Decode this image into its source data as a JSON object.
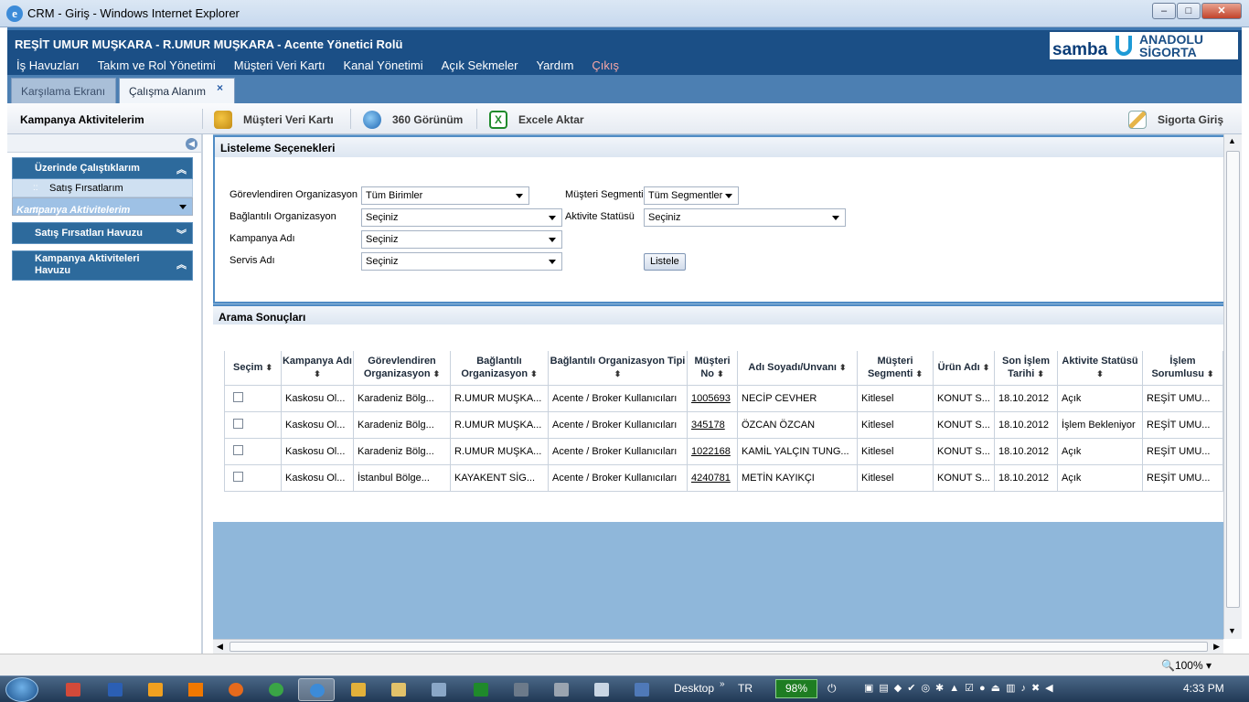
{
  "window": {
    "title": "CRM - Giriş - Windows Internet Explorer",
    "ie_icon": "e"
  },
  "header": {
    "title": "REŞİT UMUR MUŞKARA - R.UMUR MUŞKARA - Acente Yönetici Rolü",
    "logo_left": "samba",
    "logo_right_1": "ANADOLU",
    "logo_right_2": "SİGORTA"
  },
  "menu": [
    "İş Havuzları",
    "Takım ve Rol Yönetimi",
    "Müşteri Veri Kartı",
    "Kanal Yönetimi",
    "Açık Sekmeler",
    "Yardım",
    "Çıkış"
  ],
  "tabs": [
    "Karşılama Ekranı",
    "Çalışma Alanım"
  ],
  "toolbar": {
    "crumb": "Kampanya Aktivitelerim",
    "veri_karti": "Müşteri Veri Kartı",
    "gorunum": "360 Görünüm",
    "excel": "Excele Aktar",
    "sigorta": "Sigorta Giriş"
  },
  "sidebar": {
    "group1": "Üzerinde Çalıştıklarım",
    "items": [
      "Satış Fırsatlarım",
      "Kampanya Aktivitelerim"
    ],
    "group2": "Satış Fırsatları Havuzu",
    "group3": "Kampanya Aktiviteleri Havuzu"
  },
  "filters": {
    "title": "Listeleme Seçenekleri",
    "gorev_label": "Görevlendiren Organizasyon",
    "gorev_value": "Tüm Birimler",
    "segment_label": "Müşteri Segmenti",
    "segment_value": "Tüm Segmentler",
    "bagli_label": "Bağlantılı Organizasyon",
    "bagli_value": "Seçiniz",
    "aktivite_label": "Aktivite Statüsü",
    "aktivite_value": "Seçiniz",
    "kampanya_label": "Kampanya Adı",
    "kampanya_value": "Seçiniz",
    "servis_label": "Servis Adı",
    "servis_value": "Seçiniz",
    "listele": "Listele"
  },
  "results": {
    "title": "Arama Sonuçları",
    "columns": [
      "Seçim",
      "Kampanya Adı",
      "Görevlendiren Organizasyon",
      "Bağlantılı Organizasyon",
      "Bağlantılı Organizasyon Tipi",
      "Müşteri No",
      "Adı Soyadı/Unvanı",
      "Müşteri Segmenti",
      "Ürün Adı",
      "Son İşlem Tarihi",
      "Aktivite Statüsü",
      "İşlem Sorumlusu"
    ],
    "rows": [
      [
        "Kaskosu Ol...",
        "Karadeniz Bölg...",
        "R.UMUR MUŞKA...",
        "Acente / Broker Kullanıcıları",
        "1005693",
        "NECİP CEVHER",
        "Kitlesel",
        "KONUT S...",
        "18.10.2012",
        "Açık",
        "REŞİT UMU..."
      ],
      [
        "Kaskosu Ol...",
        "Karadeniz Bölg...",
        "R.UMUR MUŞKA...",
        "Acente / Broker Kullanıcıları",
        "345178",
        "ÖZCAN ÖZCAN",
        "Kitlesel",
        "KONUT S...",
        "18.10.2012",
        "İşlem Bekleniyor",
        "REŞİT UMU..."
      ],
      [
        "Kaskosu Ol...",
        "Karadeniz Bölg...",
        "R.UMUR MUŞKA...",
        "Acente / Broker Kullanıcıları",
        "1022168",
        "KAMİL YALÇIN TUNG...",
        "Kitlesel",
        "KONUT S...",
        "18.10.2012",
        "Açık",
        "REŞİT UMU..."
      ],
      [
        "Kaskosu Ol...",
        "İstanbul Bölge...",
        "KAYAKENT SİG...",
        "Acente / Broker Kullanıcıları",
        "4240781",
        "METİN KAYIKÇI",
        "Kitlesel",
        "KONUT S...",
        "18.10.2012",
        "Açık",
        "REŞİT UMU..."
      ]
    ]
  },
  "statusbar": {
    "zoom": "100%"
  },
  "taskbar": {
    "desktop": "Desktop",
    "lang": "TR",
    "battery": "98%",
    "time": "4:33 PM"
  }
}
